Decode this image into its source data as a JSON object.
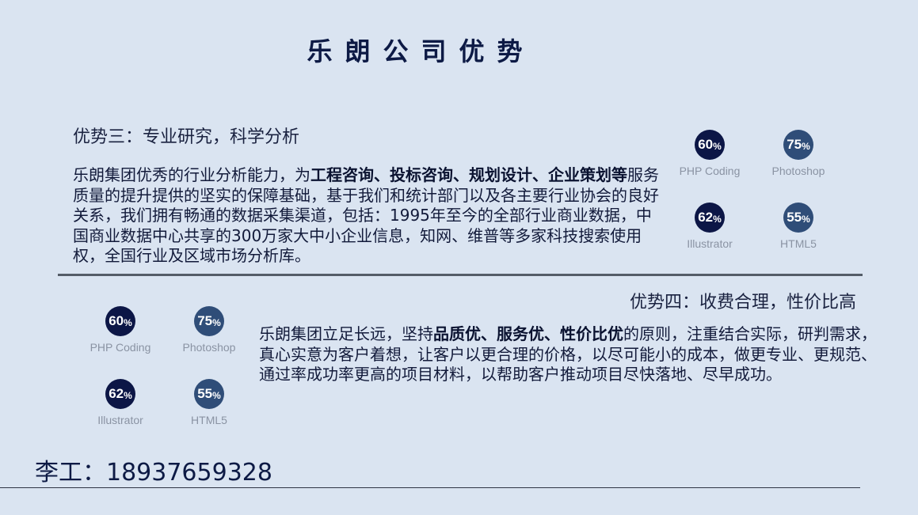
{
  "page": {
    "title": "乐朗公司优势"
  },
  "section3": {
    "heading": "优势三：专业研究，科学分析",
    "paragraph": [
      {
        "text": "乐朗集团优秀的行业分析能力，为",
        "bold": false
      },
      {
        "text": "工程咨询、投标咨询、规划设计、企业策划等",
        "bold": true
      },
      {
        "text": "服务质量的提升提供的坚实的保障基础，基于我们和统计部门以及各主要行业协会的良好关系，我们拥有畅通的数据采集渠道，包括：1995年至今的全部行业商业数据，中国商业数据中心共享的300万家大中小企业信息，知网、维普等多家科技搜索使用权，全国行业及区域市场分析库。",
        "bold": false
      }
    ],
    "skills": [
      {
        "value": "60",
        "unit": "%",
        "label": "PHP Coding",
        "color": "#0c1646"
      },
      {
        "value": "75",
        "unit": "%",
        "label": "Photoshop",
        "color": "#2f4d78"
      },
      {
        "value": "62",
        "unit": "%",
        "label": "Illustrator",
        "color": "#0c1646"
      },
      {
        "value": "55",
        "unit": "%",
        "label": "HTML5",
        "color": "#2f4d78"
      }
    ]
  },
  "section4": {
    "heading": "优势四：收费合理，性价比高",
    "paragraph": [
      {
        "text": "乐朗集团立足长远，坚持",
        "bold": false
      },
      {
        "text": "品质优、服务优、性价比优",
        "bold": true
      },
      {
        "text": "的原则，注重结合实际，研判需求，真心实意为客户着想，让客户以更合理的价格，以尽可能小的成本，做更专业、更规范、通过率成功率更高的项目材料，以帮助客户推动项目尽快落地、尽早成功。",
        "bold": false
      }
    ],
    "skills": [
      {
        "value": "60",
        "unit": "%",
        "label": "PHP Coding",
        "color": "#0c1646"
      },
      {
        "value": "75",
        "unit": "%",
        "label": "Photoshop",
        "color": "#2f4d78"
      },
      {
        "value": "62",
        "unit": "%",
        "label": "Illustrator",
        "color": "#0c1646"
      },
      {
        "value": "55",
        "unit": "%",
        "label": "HTML5",
        "color": "#2f4d78"
      }
    ]
  },
  "contact": {
    "text": "李工：18937659328"
  },
  "colors": {
    "background": "#dae4f1",
    "title": "#0d1a45",
    "dark_circle": "#0c1646",
    "light_circle": "#2f4d78",
    "divider": "#545c68"
  }
}
